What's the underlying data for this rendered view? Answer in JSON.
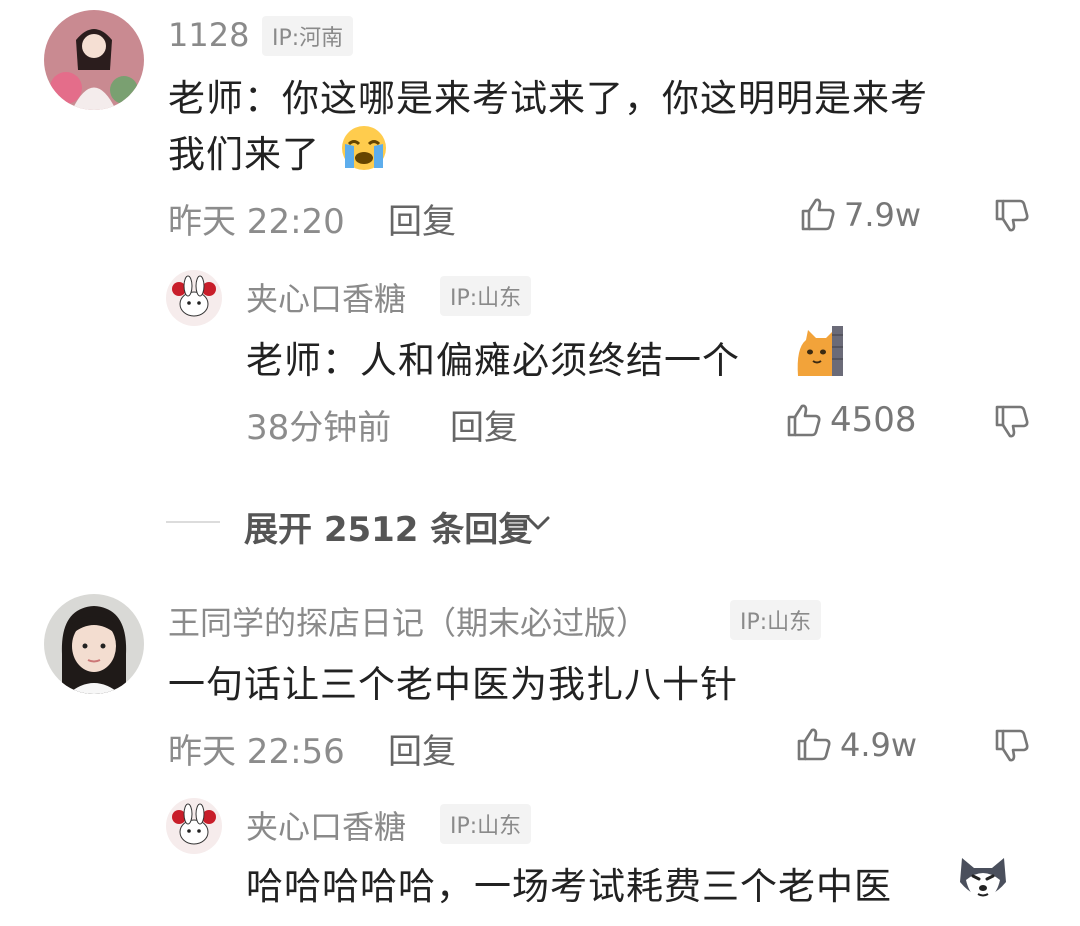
{
  "comments": [
    {
      "username": "1128",
      "ip": "IP:河南",
      "text_line1": "老师：你这哪是来考试来了，你这明明是来考",
      "text_line2": "我们来了",
      "emoji": "crying-emoji",
      "time": "昨天 22:20",
      "reply_label": "回复",
      "likes": "7.9w"
    },
    {
      "username": "王同学的探店日记（期末必过版）",
      "ip": "IP:山东",
      "text": "一句话让三个老中医为我扎八十针",
      "time": "昨天 22:56",
      "reply_label": "回复",
      "likes": "4.9w"
    }
  ],
  "replies": [
    {
      "username": "夹心口香糖",
      "ip": "IP:山东",
      "text": "老师：人和偏瘫必须终结一个",
      "emoji": "peeking-cat-emoji",
      "time": "38分钟前",
      "reply_label": "回复",
      "likes": "4508"
    },
    {
      "username": "夹心口香糖",
      "ip": "IP:山东",
      "text": "哈哈哈哈哈，一场考试耗费三个老中医",
      "emoji": "husky-emoji"
    }
  ],
  "expand": {
    "label": "展开 2512 条回复"
  },
  "colors": {
    "text": "#222222",
    "meta": "#8c8c8c",
    "tag_bg": "#f3f3f3"
  }
}
